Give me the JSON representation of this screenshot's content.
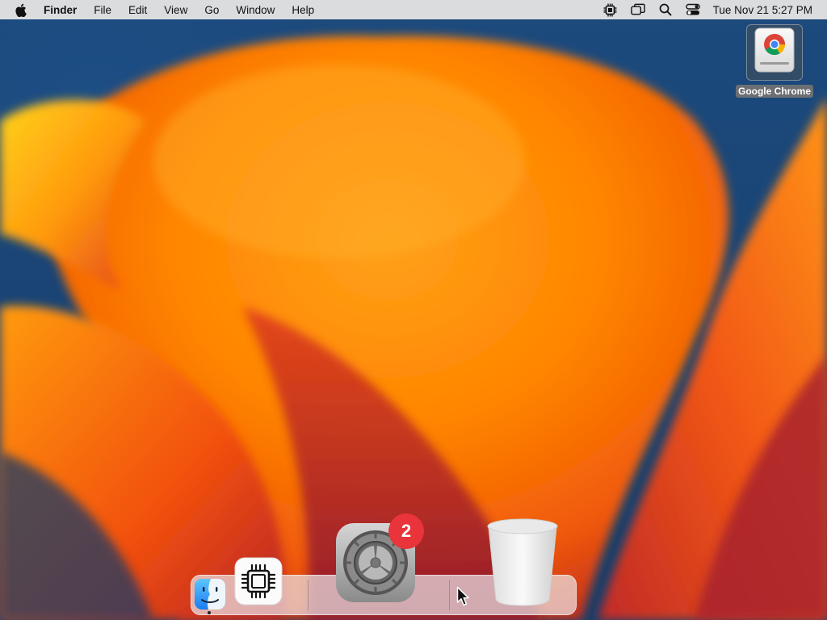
{
  "menubar": {
    "app_name": "Finder",
    "menus": [
      "File",
      "Edit",
      "View",
      "Go",
      "Window",
      "Help"
    ],
    "status_icons": [
      "cpu-monitor-icon",
      "screen-mirroring-icon",
      "spotlight-search-icon",
      "control-center-icon"
    ],
    "clock": "Tue Nov 21  5:27 PM"
  },
  "desktop": {
    "icons": [
      {
        "label": "Google Chrome",
        "icon": "chrome-disk-image-icon"
      }
    ]
  },
  "dock": {
    "apps": [
      {
        "name": "Finder",
        "icon": "finder-icon",
        "running": true
      },
      {
        "name": "CPU Monitor",
        "icon": "cpu-chip-icon",
        "running": false
      },
      {
        "name": "System Settings",
        "icon": "system-settings-gear-icon",
        "badge": "2"
      },
      {
        "name": "Trash",
        "icon": "trash-icon"
      }
    ]
  },
  "colors": {
    "badge": "#e8343a",
    "wallpaper_orange": "#ff8a00",
    "wallpaper_blue": "#1c4a7d",
    "menubar": "#ebe8e6"
  }
}
